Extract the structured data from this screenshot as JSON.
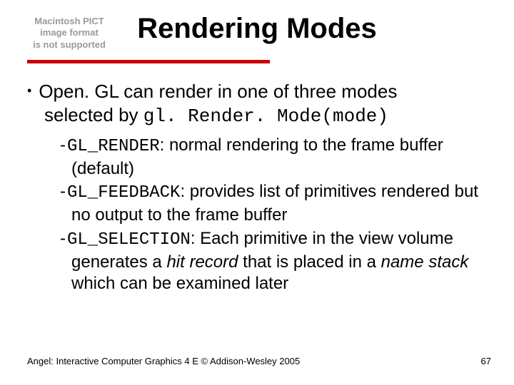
{
  "placeholder": {
    "line1": "Macintosh PICT",
    "line2": "image format",
    "line3": "is not supported"
  },
  "title": "Rendering Modes",
  "lead": {
    "part1": "Open. GL can render in one of three modes",
    "part2_pre": "selected by ",
    "code": "gl. Render. Mode(mode)"
  },
  "items": [
    {
      "code": "GL_RENDER",
      "text_after_code": ": normal rendering to the frame buffer (default)"
    },
    {
      "code": "GL_FEEDBACK",
      "text_after_code": ": provides list of primitives rendered but no output to the frame buffer"
    },
    {
      "code": "GL_SELECTION",
      "text1": ": Each primitive in the view volume generates a ",
      "italic1": "hit record",
      "text2": " that is placed in a ",
      "italic2": "name stack",
      "text3": " which can be examined later"
    }
  ],
  "footer": "Angel: Interactive Computer Graphics 4 E © Addison-Wesley 2005",
  "page_number": "67"
}
